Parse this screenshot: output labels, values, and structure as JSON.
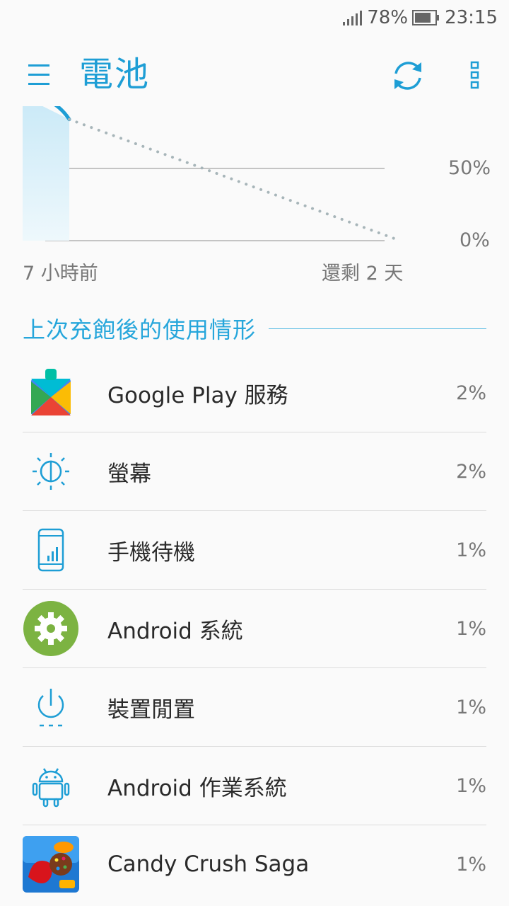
{
  "status": {
    "battery_percent": "78%",
    "time": "23:15"
  },
  "appbar": {
    "title": "電池"
  },
  "chart": {
    "label_50": "50%",
    "label_0": "0%",
    "left_label": "7 小時前",
    "right_label": "還剩 2 天"
  },
  "chart_data": {
    "type": "line",
    "x_range": [
      "7 小時前",
      "還剩 2 天"
    ],
    "y_ticks": [
      "50%",
      "0%"
    ],
    "series": [
      {
        "values": [
          100,
          84
        ]
      },
      {
        "values": [
          84,
          0
        ]
      }
    ],
    "ylim": [
      0,
      100
    ]
  },
  "section": {
    "title": "上次充飽後的使用情形"
  },
  "usage": [
    {
      "label": "Google Play 服務",
      "percent": "2%",
      "icon": "google-play-services-icon"
    },
    {
      "label": "螢幕",
      "percent": "2%",
      "icon": "screen-brightness-icon"
    },
    {
      "label": "手機待機",
      "percent": "1%",
      "icon": "phone-standby-icon"
    },
    {
      "label": "Android 系統",
      "percent": "1%",
      "icon": "android-system-gear-icon"
    },
    {
      "label": "裝置閒置",
      "percent": "1%",
      "icon": "device-idle-power-icon"
    },
    {
      "label": "Android 作業系統",
      "percent": "1%",
      "icon": "android-os-robot-icon"
    },
    {
      "label": "Candy Crush Saga",
      "percent": "1%",
      "icon": "candy-crush-saga-icon"
    }
  ],
  "colors": {
    "accent": "#1e9ed5",
    "section": "#26a6db"
  }
}
